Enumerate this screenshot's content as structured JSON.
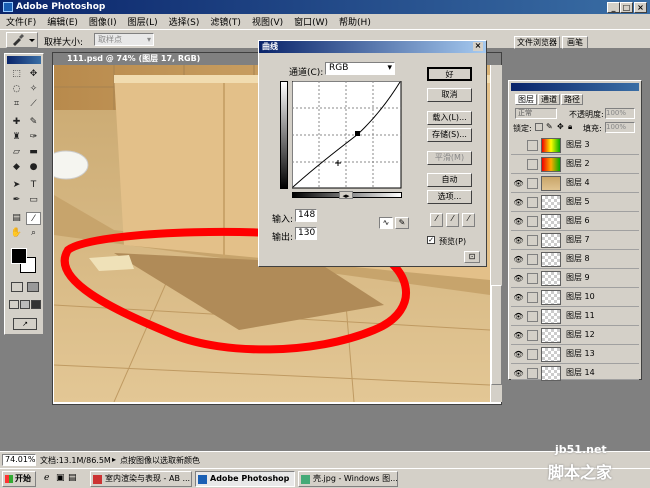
{
  "window": {
    "title": "Adobe Photoshop"
  },
  "menu": [
    "文件(F)",
    "编辑(E)",
    "图像(I)",
    "图层(L)",
    "选择(S)",
    "滤镜(T)",
    "视图(V)",
    "窗口(W)",
    "帮助(H)"
  ],
  "options": {
    "sample_size_label": "取样大小:",
    "sample_size_value": "取样点",
    "tab_file_browser": "文件浏览器",
    "tab_brushes": "画笔"
  },
  "document": {
    "title": "111.psd @ 74% (图层 17, RGB)"
  },
  "curves": {
    "title": "曲线",
    "channel_label": "通道(C):",
    "channel_value": "RGB",
    "input_label": "输入:",
    "input_value": "148",
    "output_label": "输出:",
    "output_value": "130",
    "buttons": {
      "ok": "好",
      "cancel": "取消",
      "load": "载入(L)...",
      "save": "存储(S)...",
      "smooth": "平滑(M)",
      "auto": "自动",
      "options": "选项..."
    },
    "preview_label": "预览(P)",
    "preview_checked": true
  },
  "layers_panel": {
    "tabs": [
      "图层",
      "通道",
      "路径"
    ],
    "blend_mode": "正常",
    "opacity_label": "不透明度:",
    "opacity_value": "100%",
    "lock_label": "锁定:",
    "fill_label": "填充:",
    "fill_value": "100%",
    "layers": [
      {
        "name": "图层 3",
        "visible": false
      },
      {
        "name": "图层 2",
        "visible": false
      },
      {
        "name": "图层 4",
        "visible": true
      },
      {
        "name": "图层 5",
        "visible": true
      },
      {
        "name": "图层 6",
        "visible": true
      },
      {
        "name": "图层 7",
        "visible": true
      },
      {
        "name": "图层 8",
        "visible": true
      },
      {
        "name": "图层 9",
        "visible": true
      },
      {
        "name": "图层 10",
        "visible": true
      },
      {
        "name": "图层 11",
        "visible": true
      },
      {
        "name": "图层 12",
        "visible": true
      },
      {
        "name": "图层 13",
        "visible": true
      },
      {
        "name": "图层 14",
        "visible": true
      }
    ]
  },
  "status": {
    "zoom": "74.01%",
    "doc_size": "文档:13.1M/86.5M",
    "hint": "点按图像以选取新颜色"
  },
  "taskbar": {
    "start": "开始",
    "tasks": [
      "室内渲染与表现 - AB ...",
      "Adobe Photoshop",
      "壳.jpg - Windows 图..."
    ]
  },
  "watermark": {
    "site": "jb51.net",
    "name": "脚本之家"
  },
  "colors": {
    "title_bar": "#0a246a",
    "highlight_stroke": "#ff0000",
    "wall_tile": "#c9a66a",
    "floor_tile": "#d9b982"
  }
}
